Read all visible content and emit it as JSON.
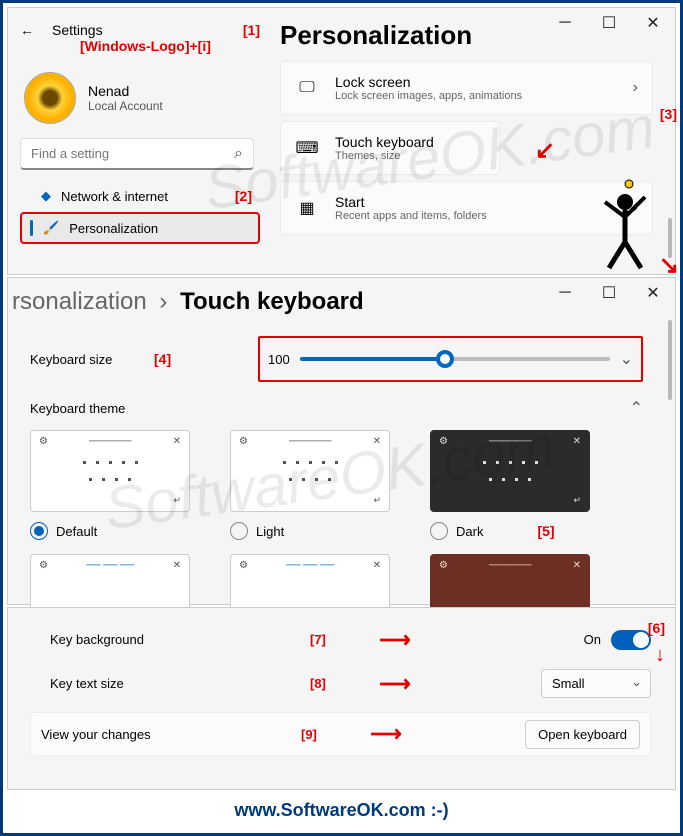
{
  "annotations": {
    "a1": "[1]",
    "a1b": "[Windows-Logo]+[i]",
    "a2": "[2]",
    "a3": "[3]",
    "a4": "[4]",
    "a5": "[5]",
    "a6": "[6]",
    "a7": "[7]",
    "a8": "[8]",
    "a9": "[9]"
  },
  "panel1": {
    "back_label": "Settings",
    "user_name": "Nenad",
    "user_sub": "Local Account",
    "search_placeholder": "Find a setting",
    "nav": {
      "network": "Network & internet",
      "personalization": "Personalization"
    },
    "title": "Personalization",
    "cards": {
      "lock": {
        "title": "Lock screen",
        "sub": "Lock screen images, apps, animations"
      },
      "touch": {
        "title": "Touch keyboard",
        "sub": "Themes, size"
      },
      "start": {
        "title": "Start",
        "sub": "Recent apps and items, folders"
      }
    }
  },
  "panel2": {
    "crumb_a": "rsonalization",
    "crumb_sep": "›",
    "crumb_b": "Touch keyboard",
    "size_label": "Keyboard size",
    "size_value": "100",
    "theme_label": "Keyboard theme",
    "themes": {
      "default": "Default",
      "light": "Light",
      "dark": "Dark"
    }
  },
  "panel3": {
    "key_bg": "Key background",
    "key_bg_state": "On",
    "key_text": "Key text size",
    "key_text_value": "Small",
    "view": "View your changes",
    "open_btn": "Open keyboard"
  },
  "footer": "www.SoftwareOK.com :-)",
  "watermark": "SoftwareOK.com"
}
